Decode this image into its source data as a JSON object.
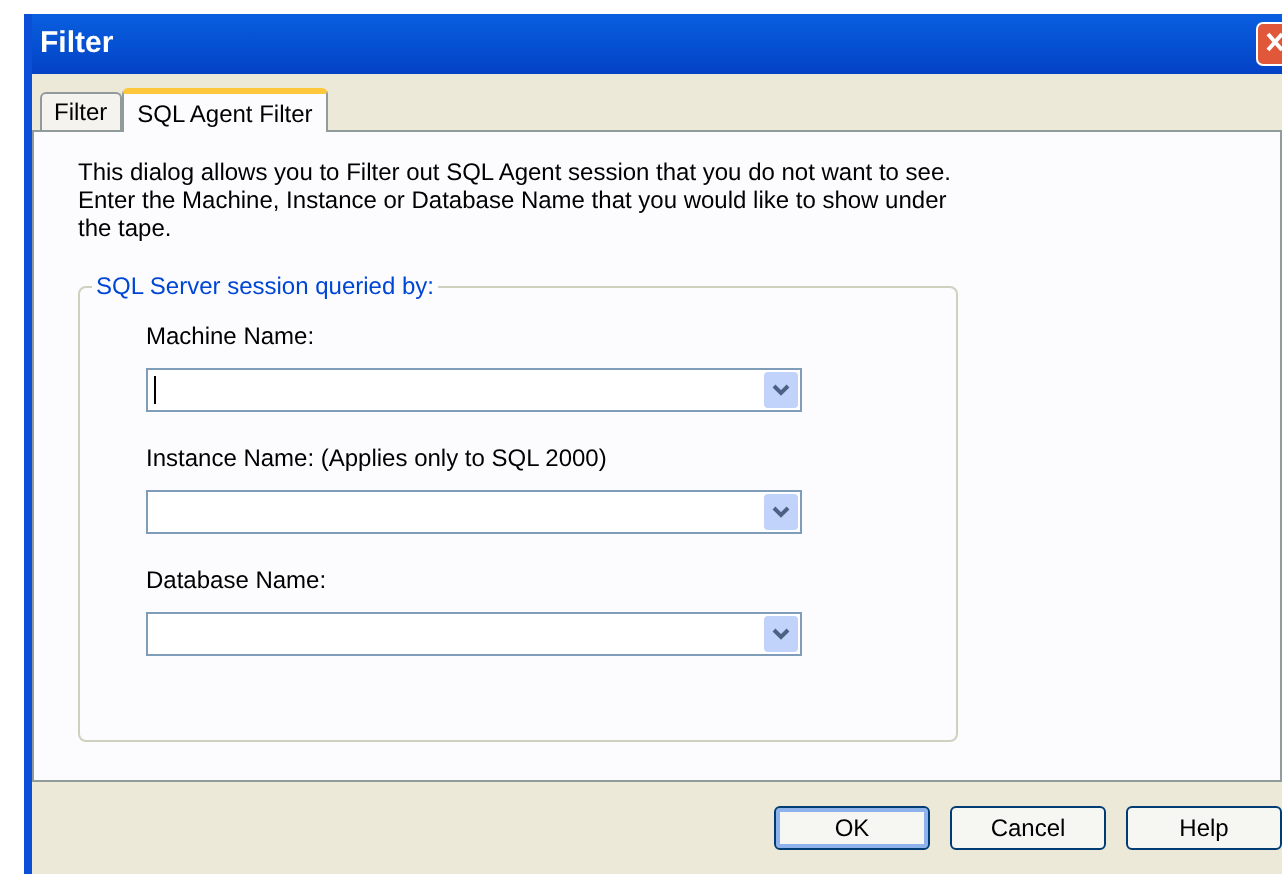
{
  "window": {
    "title": "Filter"
  },
  "tabs": [
    {
      "label": "Filter",
      "selected": false
    },
    {
      "label": "SQL Agent Filter",
      "selected": true
    }
  ],
  "description": "This dialog allows you to Filter out SQL Agent session that you do not want to see. Enter the Machine, Instance or Database Name that you would like to show under the tape.",
  "group": {
    "title": "SQL Server session queried by:",
    "fields": [
      {
        "label": "Machine Name:",
        "focused": true
      },
      {
        "label": "Instance Name: (Applies only to SQL 2000)",
        "focused": false
      },
      {
        "label": "Database Name:",
        "focused": false
      }
    ]
  },
  "buttons": [
    {
      "label": "OK",
      "default": true
    },
    {
      "label": "Cancel",
      "default": false
    },
    {
      "label": "Help",
      "default": false
    }
  ]
}
